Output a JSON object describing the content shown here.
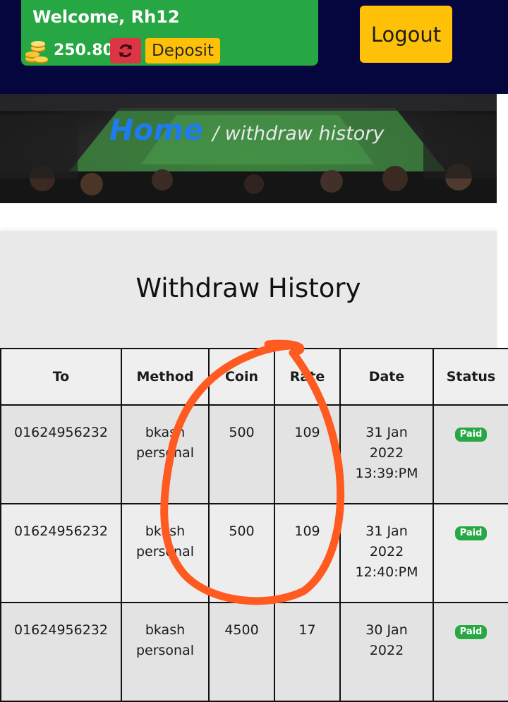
{
  "header": {
    "welcome": "Welcome, Rh12",
    "balance": "250.80",
    "deposit_label": "Deposit",
    "logout_label": "Logout"
  },
  "banner": {
    "home_label": "Home",
    "current_page": "/ withdraw history"
  },
  "panel": {
    "title": "Withdraw History"
  },
  "table": {
    "columns": [
      "To",
      "Method",
      "Coin",
      "Rate",
      "Date",
      "Status"
    ],
    "rows": [
      {
        "to": "01624956232",
        "method_1": "bkash",
        "method_2": "personal",
        "coin": "500",
        "rate": "109",
        "date_1": "31 Jan",
        "date_2": "2022",
        "date_3": "13:39:PM",
        "status": "Paid"
      },
      {
        "to": "01624956232",
        "method_1": "bkash",
        "method_2": "personal",
        "coin": "500",
        "rate": "109",
        "date_1": "31 Jan",
        "date_2": "2022",
        "date_3": "12:40:PM",
        "status": "Paid"
      },
      {
        "to": "01624956232",
        "method_1": "bkash",
        "method_2": "personal",
        "coin": "4500",
        "rate": "17",
        "date_1": "30 Jan",
        "date_2": "2022",
        "date_3": "",
        "status": "Paid"
      }
    ]
  },
  "colors": {
    "header_bg": "#05063d",
    "welcome_green": "#26a744",
    "accent_yellow": "#ffc107",
    "refresh_red": "#dc3545",
    "home_blue": "#1e7bf0",
    "paid_green": "#28a745",
    "annotation_orange": "#ff5a1f"
  },
  "icons": [
    "coins-icon",
    "refresh-icon"
  ]
}
